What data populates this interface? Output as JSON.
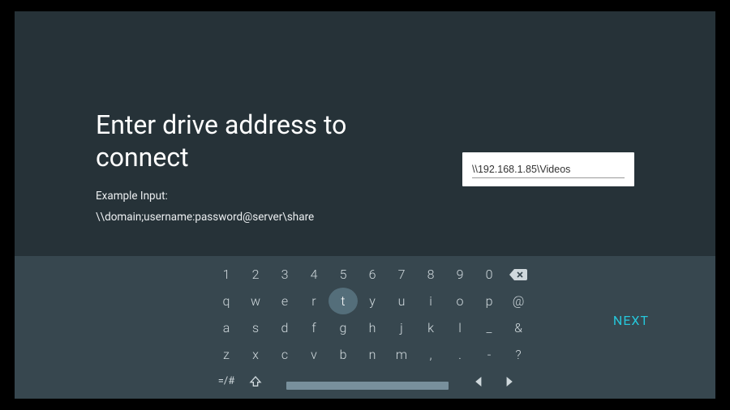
{
  "title": "Enter drive address to connect",
  "example_label": "Example Input:",
  "example_value": "\\\\domain;username:password@server\\share",
  "input_value": "\\\\192.168.1.85\\Videos",
  "next_label": "NEXT",
  "symbol_key": "=/#",
  "keyboard": {
    "row1": [
      "1",
      "2",
      "3",
      "4",
      "5",
      "6",
      "7",
      "8",
      "9",
      "0"
    ],
    "row2": [
      "q",
      "w",
      "e",
      "r",
      "t",
      "y",
      "u",
      "i",
      "o",
      "p",
      "@"
    ],
    "row3": [
      "a",
      "s",
      "d",
      "f",
      "g",
      "h",
      "j",
      "k",
      "l",
      "_",
      "&"
    ],
    "row4": [
      "z",
      "x",
      "c",
      "v",
      "b",
      "n",
      "m",
      ",",
      ".",
      "-",
      "?"
    ],
    "focused": "t"
  }
}
